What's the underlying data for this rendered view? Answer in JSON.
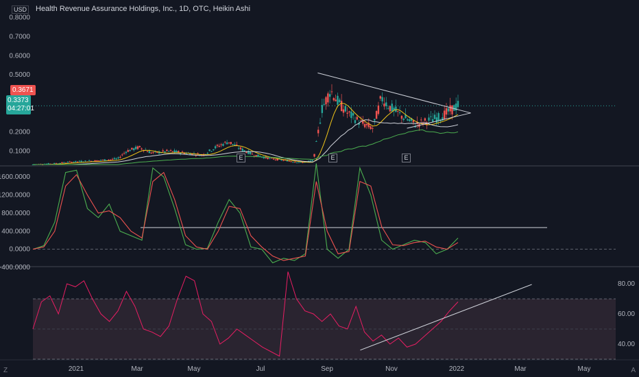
{
  "header": {
    "title": "Health Revenue Assurance Holdings, Inc., 1D, OTC, Heikin Ashi",
    "currency": "USD",
    "price_label": "0.3671",
    "countdown_price": "0.3373",
    "countdown_time": "04:27:01"
  },
  "buttons": {
    "z": "Z",
    "a": "A"
  },
  "earnings_markers": [
    "E",
    "E",
    "E"
  ],
  "colors": {
    "background": "#131722",
    "bull": "#26a69a",
    "bear": "#ef5350",
    "sma_fast": "#f0c419",
    "sma_mid": "#d1d4dc",
    "sma_slow": "#4caf50",
    "osc_fast": "#4caf50",
    "osc_slow": "#ef5350",
    "rsi": "#e91e63",
    "rsi_band": "#2a2430"
  },
  "chart_data": [
    {
      "type": "candlestick",
      "title": "Health Revenue Assurance Holdings, Inc., 1D, OTC, Heikin Ashi",
      "ylabel": "USD",
      "ylim": [
        0.03,
        0.82
      ],
      "yticks": [
        0.1,
        0.2,
        0.3,
        0.4,
        0.5,
        0.6,
        0.7,
        0.8
      ],
      "ytick_labels": [
        "0.1000",
        "0.2000",
        "",
        "",
        "0.5000",
        "0.6000",
        "0.7000",
        "0.8000"
      ],
      "x_ticks": [
        "2021",
        "Mar",
        "May",
        "Jul",
        "Sep",
        "Nov",
        "2022",
        "Mar",
        "May"
      ],
      "last_price": 0.3671,
      "current_price": 0.3373,
      "price_points": [
        {
          "t": 0.0,
          "v": 0.03
        },
        {
          "t": 0.05,
          "v": 0.035
        },
        {
          "t": 0.1,
          "v": 0.045
        },
        {
          "t": 0.15,
          "v": 0.05
        },
        {
          "t": 0.2,
          "v": 0.06
        },
        {
          "t": 0.22,
          "v": 0.1
        },
        {
          "t": 0.25,
          "v": 0.12
        },
        {
          "t": 0.28,
          "v": 0.09
        },
        {
          "t": 0.32,
          "v": 0.1
        },
        {
          "t": 0.36,
          "v": 0.09
        },
        {
          "t": 0.4,
          "v": 0.08
        },
        {
          "t": 0.43,
          "v": 0.12
        },
        {
          "t": 0.46,
          "v": 0.15
        },
        {
          "t": 0.49,
          "v": 0.11
        },
        {
          "t": 0.52,
          "v": 0.08
        },
        {
          "t": 0.56,
          "v": 0.06
        },
        {
          "t": 0.6,
          "v": 0.05
        },
        {
          "t": 0.63,
          "v": 0.04
        },
        {
          "t": 0.66,
          "v": 0.05
        },
        {
          "t": 0.68,
          "v": 0.32
        },
        {
          "t": 0.7,
          "v": 0.42
        },
        {
          "t": 0.72,
          "v": 0.35
        },
        {
          "t": 0.74,
          "v": 0.3
        },
        {
          "t": 0.77,
          "v": 0.25
        },
        {
          "t": 0.8,
          "v": 0.22
        },
        {
          "t": 0.82,
          "v": 0.38
        },
        {
          "t": 0.84,
          "v": 0.33
        },
        {
          "t": 0.87,
          "v": 0.28
        },
        {
          "t": 0.9,
          "v": 0.24
        },
        {
          "t": 0.93,
          "v": 0.26
        },
        {
          "t": 0.96,
          "v": 0.28
        },
        {
          "t": 1.0,
          "v": 0.34
        }
      ],
      "trendlines": [
        {
          "name": "upper",
          "from": {
            "t": 0.67,
            "v": 0.51
          },
          "to": {
            "t": 1.03,
            "v": 0.3
          }
        },
        {
          "name": "lower",
          "from": {
            "t": 0.88,
            "v": 0.22
          },
          "to": {
            "t": 1.03,
            "v": 0.3
          }
        }
      ]
    },
    {
      "type": "line",
      "ylim": [
        -400,
        1800
      ],
      "yticks": [
        -400,
        0,
        400,
        800,
        1200,
        1600
      ],
      "ytick_labels": [
        "-400.0000",
        "0.0000",
        "400.0000",
        "800.0000",
        "1200.0000",
        "1600.0000"
      ],
      "horizontal_level": 480,
      "series": [
        {
          "values": [
            0,
            80,
            600,
            1700,
            1750,
            900,
            700,
            1000,
            400,
            300,
            200,
            1800,
            1600,
            900,
            100,
            0,
            20,
            600,
            1100,
            800,
            50,
            0,
            -300,
            -200,
            -250,
            -100,
            1900,
            0,
            -200,
            0,
            1800,
            1200,
            200,
            0,
            100,
            200,
            150,
            -100,
            0,
            250
          ]
        },
        {
          "values": [
            0,
            50,
            400,
            1400,
            1650,
            1200,
            800,
            850,
            700,
            400,
            250,
            1500,
            1700,
            1100,
            300,
            50,
            0,
            400,
            950,
            900,
            300,
            50,
            -150,
            -250,
            -200,
            -150,
            1500,
            400,
            -100,
            -50,
            1500,
            1400,
            500,
            100,
            80,
            150,
            180,
            50,
            0,
            150
          ]
        }
      ]
    },
    {
      "type": "line",
      "ylim": [
        30,
        90
      ],
      "yticks": [
        40,
        60,
        80
      ],
      "ytick_labels": [
        "40.00",
        "60.00",
        "80.00"
      ],
      "band": [
        30,
        70
      ],
      "midline": 50,
      "series": [
        {
          "values": [
            50,
            68,
            72,
            60,
            80,
            78,
            82,
            70,
            60,
            55,
            62,
            75,
            65,
            50,
            48,
            45,
            52,
            70,
            85,
            82,
            60,
            55,
            40,
            44,
            50,
            46,
            42,
            38,
            35,
            32,
            88,
            70,
            62,
            60,
            55,
            60,
            52,
            50,
            65,
            48,
            42,
            46,
            40,
            44,
            38,
            40,
            45,
            50,
            55,
            62,
            68
          ]
        }
      ],
      "trendline": {
        "from": {
          "t": 0.77,
          "v": 36
        },
        "to": {
          "t": 0.98,
          "v": 85
        }
      }
    }
  ]
}
